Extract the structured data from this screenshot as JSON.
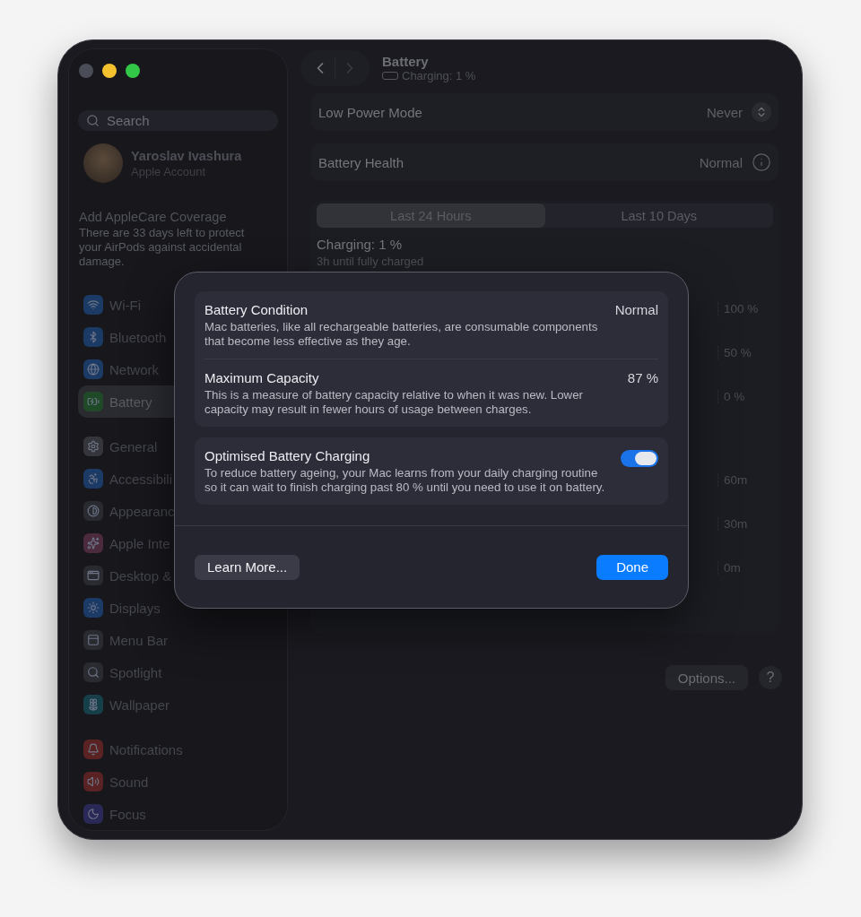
{
  "window": {
    "controls": [
      {
        "color": "#4a4d57"
      },
      {
        "color": "#f5c12e"
      },
      {
        "color": "#33c748"
      }
    ]
  },
  "sidebar": {
    "search": {
      "placeholder": "Search"
    },
    "account": {
      "name": "Yaroslav Ivashura",
      "subtitle": "Apple Account"
    },
    "promo": {
      "title": "Add AppleCare Coverage",
      "text": "There are 33 days left to protect your AirPods against accidental damage."
    },
    "sections": [
      {
        "items": [
          {
            "label": "Wi-Fi",
            "color": "#1c3a66",
            "selected": false
          },
          {
            "label": "Bluetooth",
            "color": "#1c3a66",
            "selected": false
          },
          {
            "label": "Network",
            "color": "#1c3a66",
            "selected": false
          },
          {
            "label": "Battery",
            "color": "#1f4a28",
            "selected": true
          }
        ]
      },
      {
        "items": [
          {
            "label": "General",
            "color": "#34363c",
            "selected": false
          },
          {
            "label": "Accessibili",
            "color": "#1c3a66",
            "selected": false
          },
          {
            "label": "Appearanc",
            "color": "#2a2b31",
            "selected": false
          },
          {
            "label": "Apple Inte",
            "color": "#4a2a3c",
            "selected": false
          },
          {
            "label": "Desktop &",
            "color": "#2a2b31",
            "selected": false
          },
          {
            "label": "Displays",
            "color": "#1c3a66",
            "selected": false
          },
          {
            "label": "Menu Bar",
            "color": "#2a2b31",
            "selected": false
          },
          {
            "label": "Spotlight",
            "color": "#2a2b31",
            "selected": false
          },
          {
            "label": "Wallpaper",
            "color": "#163f4a",
            "selected": false
          }
        ]
      },
      {
        "items": [
          {
            "label": "Notifications",
            "color": "#5a2222",
            "selected": false
          },
          {
            "label": "Sound",
            "color": "#5a2222",
            "selected": false
          },
          {
            "label": "Focus",
            "color": "#2a2856",
            "selected": false
          }
        ]
      }
    ]
  },
  "header": {
    "title": "Battery",
    "subtitle": "Charging: 1 %"
  },
  "settings": [
    {
      "label": "Low Power Mode",
      "value": "Never",
      "kind": "popup"
    },
    {
      "label": "Battery Health",
      "value": "Normal",
      "kind": "info"
    }
  ],
  "tabs": [
    {
      "label": "Last 24 Hours",
      "selected": true
    },
    {
      "label": "Last 10 Days",
      "selected": false
    }
  ],
  "status": {
    "title": "Charging: 1 %",
    "subtitle": "3h until fully charged"
  },
  "level_axis": [
    "100 %",
    "50 %",
    "0 %"
  ],
  "usage_axis": [
    "60m",
    "30m",
    "0m"
  ],
  "buttons": {
    "options": "Options...",
    "help": "?"
  },
  "sheet": {
    "groups": [
      {
        "rows": [
          {
            "title": "Battery Condition",
            "value": "Normal",
            "kind": "value",
            "text": "Mac batteries, like all rechargeable batteries, are consumable components that become less effective as they age."
          },
          {
            "title": "Maximum Capacity",
            "value": "87 %",
            "kind": "value",
            "text": "This is a measure of battery capacity relative to when it was new. Lower capacity may result in fewer hours of usage between charges."
          }
        ]
      },
      {
        "rows": [
          {
            "title": "Optimised Battery Charging",
            "kind": "toggle",
            "on": true,
            "text": "To reduce battery ageing, your Mac learns from your daily charging routine so it can wait to finish charging past 80 % until you need to use it on battery."
          }
        ]
      }
    ],
    "secondary_button": "Learn More...",
    "primary_button": "Done"
  }
}
